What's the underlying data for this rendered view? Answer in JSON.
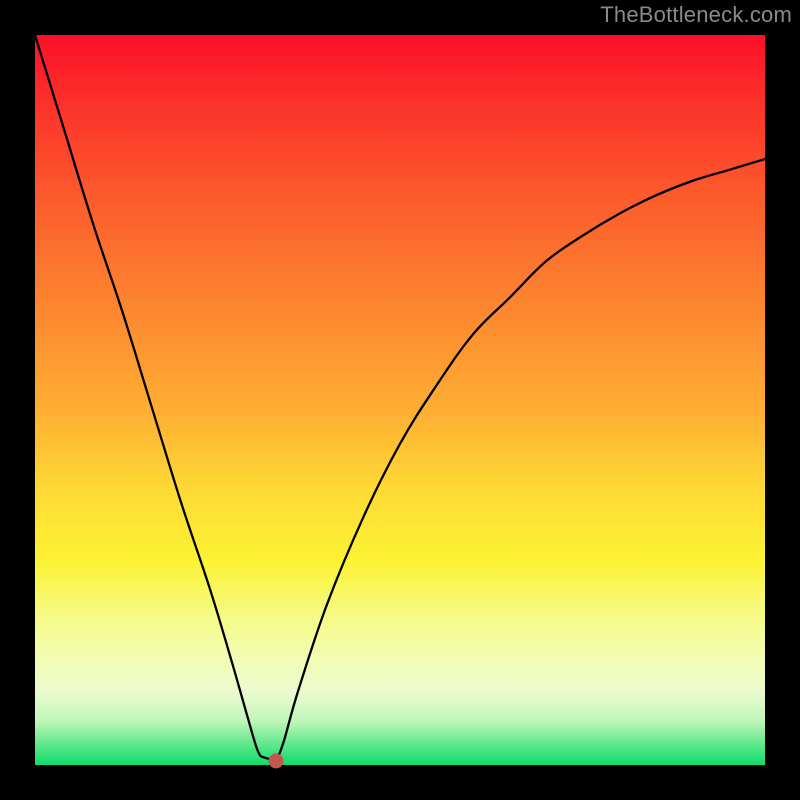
{
  "watermark": "TheBottleneck.com",
  "chart_data": {
    "type": "line",
    "title": "",
    "xlabel": "",
    "ylabel": "",
    "xlim": [
      0,
      100
    ],
    "ylim": [
      0,
      100
    ],
    "grid": false,
    "legend": false,
    "background_gradient": {
      "top": "#fb0f28",
      "middle": "#fed834",
      "bottom": "#0cdc6c"
    },
    "series": [
      {
        "name": "curve",
        "color": "#000000",
        "x": [
          0,
          4,
          8,
          12,
          16,
          20,
          24,
          27,
          29,
          30.5,
          31.5,
          33,
          34,
          36,
          40,
          45,
          50,
          55,
          60,
          65,
          70,
          75,
          80,
          85,
          90,
          95,
          100
        ],
        "y": [
          100,
          87,
          74,
          62,
          49,
          36,
          24,
          14,
          7,
          2,
          1,
          1,
          3,
          10,
          22,
          34,
          44,
          52,
          59,
          64,
          69,
          72.5,
          75.5,
          78,
          80,
          81.5,
          83
        ]
      }
    ],
    "marker": {
      "x": 33,
      "y": 0.5,
      "color": "#c1574e"
    }
  }
}
